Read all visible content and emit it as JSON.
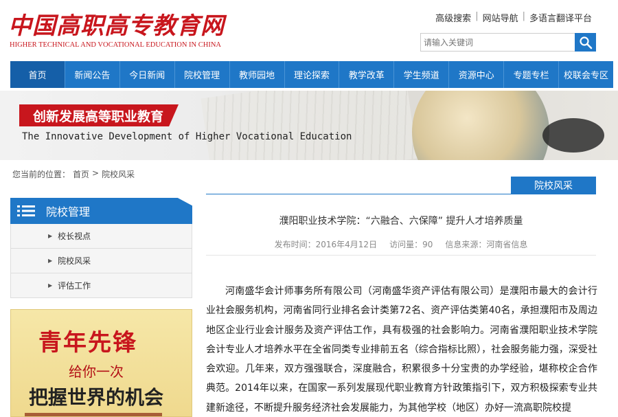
{
  "header": {
    "logo_cn": "中国高职高专教育网",
    "logo_en": "HIGHER TECHNICAL AND VOCATIONAL EDUCATION IN CHINA",
    "top_links": [
      "高级搜索",
      "网站导航",
      "多语言翻译平台"
    ],
    "search_placeholder": "请输入关键词"
  },
  "nav": [
    "首页",
    "新闻公告",
    "今日新闻",
    "院校管理",
    "教师园地",
    "理论探索",
    "教学改革",
    "学生频道",
    "资源中心",
    "专题专栏",
    "校联会专区"
  ],
  "banner": {
    "title_cn": "创新发展高等职业教育",
    "title_en": "The Innovative Development of Higher Vocational Education"
  },
  "breadcrumb": {
    "prefix": "您当前的位置：",
    "home": "首页",
    "sep": ">",
    "current": "院校风采"
  },
  "section_tag": "院校风采",
  "sidebar": {
    "title": "院校管理",
    "items": [
      "校长视点",
      "院校风采",
      "评估工作"
    ]
  },
  "poster": {
    "line1": "青年先锋",
    "line2": "给你一次",
    "line3": "把握世界的机会"
  },
  "article": {
    "title": "濮阳职业技术学院：“六融合、六保障” 提升人才培养质量",
    "date_label": "发布时间：2016年4月12日",
    "views_label": "访问量：90",
    "source_label": "信息来源：河南省信息",
    "body": "河南盛华会计师事务所有限公司（河南盛华资产评估有限公司）是濮阳市最大的会计行业社会服务机构，河南省同行业排名会计类第72名、资产评估类第40名，承担濮阳市及周边地区企业行业会计服务及资产评估工作，具有极强的社会影响力。河南省濮阳职业技术学院会计专业人才培养水平在全省同类专业排前五名（综合指标比照），社会服务能力强，深受社会欢迎。几年来，双方强强联合，深度融合，积累很多十分宝贵的办学经验，堪称校企合作典范。2014年以来，在国家一系列发展现代职业教育方针政策指引下，双方积极探索专业共建新途径，不断提升服务经济社会发展能力，为其他学校（地区）办好一流高职院校提"
  },
  "colors": {
    "brand_blue": "#1f77c7",
    "brand_red": "#c8161d"
  }
}
